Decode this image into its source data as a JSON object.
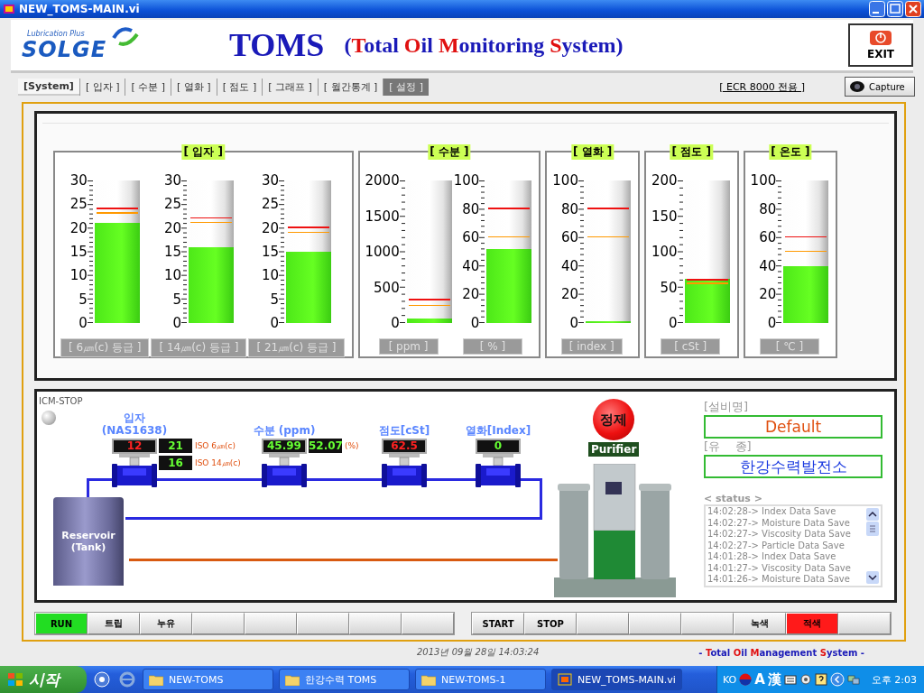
{
  "window": {
    "title": "NEW_TOMS-MAIN.vi"
  },
  "logo": {
    "tagline": "Lubrication Plus",
    "name": "SOLGE"
  },
  "heading": {
    "title": "TOMS",
    "subtitle": [
      {
        "text": "(",
        "accent": false
      },
      {
        "text": "T",
        "accent": true
      },
      {
        "text": "otal ",
        "accent": false
      },
      {
        "text": "O",
        "accent": true
      },
      {
        "text": "il ",
        "accent": false
      },
      {
        "text": "M",
        "accent": true
      },
      {
        "text": "onitoring ",
        "accent": false
      },
      {
        "text": "S",
        "accent": true
      },
      {
        "text": "ystem)",
        "accent": false
      }
    ]
  },
  "exit_button": "EXIT",
  "tabs": [
    {
      "label": "[System]",
      "selected": true,
      "disabled": false
    },
    {
      "label": "[ 입자 ]",
      "selected": false,
      "disabled": false
    },
    {
      "label": "[ 수분 ]",
      "selected": false,
      "disabled": false
    },
    {
      "label": "[ 열화 ]",
      "selected": false,
      "disabled": false
    },
    {
      "label": "[ 점도 ]",
      "selected": false,
      "disabled": false
    },
    {
      "label": "[ 그래프 ]",
      "selected": false,
      "disabled": false
    },
    {
      "label": "[ 월간통계 ]",
      "selected": false,
      "disabled": false
    },
    {
      "label": "[ 설정 ]",
      "selected": false,
      "disabled": true
    }
  ],
  "ecr_link": "[ ECR 8000 전용 ]",
  "capture_button": "Capture",
  "gauge_groups": [
    {
      "title": "[ 입자 ]",
      "gauges": [
        {
          "scale": [
            "30",
            "25",
            "20",
            "15",
            "10",
            "5",
            "0"
          ],
          "level": 0.7,
          "alarms": [
            {
              "kind": "high",
              "level": 0.8
            },
            {
              "kind": "warning",
              "level": 0.767
            }
          ],
          "unit": "[ 6㎛(c) 등급 ]"
        },
        {
          "scale": [
            "30",
            "25",
            "20",
            "15",
            "10",
            "5",
            "0"
          ],
          "level": 0.533,
          "alarms": [
            {
              "kind": "high",
              "level": 0.733
            },
            {
              "kind": "warning",
              "level": 0.7
            }
          ],
          "unit": "[ 14㎛(c) 등급 ]"
        },
        {
          "scale": [
            "30",
            "25",
            "20",
            "15",
            "10",
            "5",
            "0"
          ],
          "level": 0.5,
          "alarms": [
            {
              "kind": "high",
              "level": 0.667
            },
            {
              "kind": "warning",
              "level": 0.633
            }
          ],
          "unit": "[ 21㎛(c) 등급 ]"
        }
      ]
    },
    {
      "title": "[ 수분 ]",
      "gauges": [
        {
          "scale": [
            "2000",
            "1500",
            "1000",
            "500",
            "0"
          ],
          "level": 0.03,
          "alarms": [
            {
              "kind": "high",
              "level": 0.16
            },
            {
              "kind": "warning",
              "level": 0.12
            }
          ],
          "unit": "[ ppm ]"
        },
        {
          "scale": [
            "100",
            "80",
            "60",
            "40",
            "20",
            "0"
          ],
          "level": 0.52,
          "alarms": [
            {
              "kind": "high",
              "level": 0.8
            },
            {
              "kind": "warning",
              "level": 0.6
            }
          ],
          "unit": "[ % ]"
        }
      ]
    },
    {
      "title": "[ 열화 ]",
      "gauges": [
        {
          "scale": [
            "100",
            "80",
            "60",
            "40",
            "20",
            "0"
          ],
          "level": 0.0,
          "alarms": [
            {
              "kind": "high",
              "level": 0.8
            },
            {
              "kind": "warning",
              "level": 0.6
            }
          ],
          "unit": "[ index ]"
        }
      ]
    },
    {
      "title": "[ 점도 ]",
      "gauges": [
        {
          "scale": [
            "200",
            "150",
            "100",
            "50",
            "0"
          ],
          "level": 0.3125,
          "alarms": [
            {
              "kind": "high",
              "level": 0.3
            },
            {
              "kind": "warning",
              "level": 0.275
            }
          ],
          "unit": "[ cSt ]"
        }
      ]
    },
    {
      "title": "[ 온도 ]",
      "gauges": [
        {
          "scale": [
            "100",
            "80",
            "60",
            "40",
            "20",
            "0"
          ],
          "level": 0.4,
          "alarms": [
            {
              "kind": "high",
              "level": 0.6
            },
            {
              "kind": "warning",
              "level": 0.5
            }
          ],
          "unit": "[ ℃ ]"
        }
      ]
    }
  ],
  "icm_stop": {
    "label": "ICM-STOP",
    "on": false
  },
  "sensors": [
    {
      "title": "입자",
      "subtitle": "(NAS1638)",
      "main": {
        "value": "12",
        "alarm": true
      },
      "side": [
        {
          "value": "21",
          "alarm": false,
          "unit": "ISO 6㎛(c)"
        },
        {
          "value": "16",
          "alarm": false,
          "unit": "ISO 14㎛(c)"
        }
      ]
    },
    {
      "title": "수분 (ppm)",
      "main": {
        "value": "45.99",
        "alarm": false
      },
      "side": [
        {
          "value": "52.07",
          "alarm": false,
          "unit": "(%)"
        }
      ]
    },
    {
      "title": "점도[cSt]",
      "main": {
        "value": "62.5",
        "alarm": true
      }
    },
    {
      "title": "열화[Index]",
      "main": {
        "value": "0",
        "alarm": false
      }
    }
  ],
  "tank_label": "Reservoir (Tank)",
  "purifier": {
    "button": "정제",
    "label": "Purifier"
  },
  "equipment": {
    "name_label": "[설비명]",
    "name_value": "Default",
    "oil_label": "[유    종]",
    "oil_value": "한강수력발전소"
  },
  "status": {
    "label": "< status >",
    "lines": [
      "14:02:28-> Index Data Save",
      "14:02:27-> Moisture Data Save",
      "14:02:27-> Viscosity Data Save",
      "14:02:27-> Particle Data Save",
      "14:01:28-> Index Data Save",
      "14:01:27-> Viscosity Data Save",
      "14:01:26-> Moisture Data Save"
    ]
  },
  "left_buttons": [
    {
      "kind": "label",
      "label": "RUN",
      "color": "#22dd22"
    },
    {
      "kind": "label",
      "label": "트립"
    },
    {
      "kind": "label",
      "label": "누유"
    },
    {
      "kind": "blank"
    },
    {
      "kind": "blank"
    },
    {
      "kind": "blank"
    },
    {
      "kind": "blank"
    },
    {
      "kind": "blank"
    }
  ],
  "right_buttons": [
    {
      "kind": "label",
      "label": "START"
    },
    {
      "kind": "label",
      "label": "STOP"
    },
    {
      "kind": "blank"
    },
    {
      "kind": "blank"
    },
    {
      "kind": "blank"
    },
    {
      "kind": "label",
      "label": "녹색"
    },
    {
      "kind": "label",
      "label": "적색",
      "color": "#ff1a1a"
    },
    {
      "kind": "blank"
    }
  ],
  "status_bar": {
    "datetime": "2013년 09월 28일 14:03:24",
    "brand": [
      {
        "text": "- ",
        "accent": false
      },
      {
        "text": "T",
        "accent": true
      },
      {
        "text": "otal ",
        "accent": false
      },
      {
        "text": "O",
        "accent": true
      },
      {
        "text": "il ",
        "accent": false
      },
      {
        "text": "M",
        "accent": true
      },
      {
        "text": "anagement ",
        "accent": false
      },
      {
        "text": "S",
        "accent": true
      },
      {
        "text": "ystem -",
        "accent": false
      }
    ]
  },
  "taskbar": {
    "start": "시작",
    "tasks": [
      {
        "label": "NEW-TOMS",
        "selected": false,
        "kind": "folder"
      },
      {
        "label": "한강수력 TOMS",
        "selected": false,
        "kind": "folder"
      },
      {
        "label": "NEW-TOMS-1",
        "selected": false,
        "kind": "folder"
      },
      {
        "label": "NEW_TOMS-MAIN.vi",
        "selected": true,
        "kind": "app"
      }
    ],
    "ime": [
      "KO",
      "A",
      "漢"
    ],
    "clock": "오후 2:03"
  }
}
